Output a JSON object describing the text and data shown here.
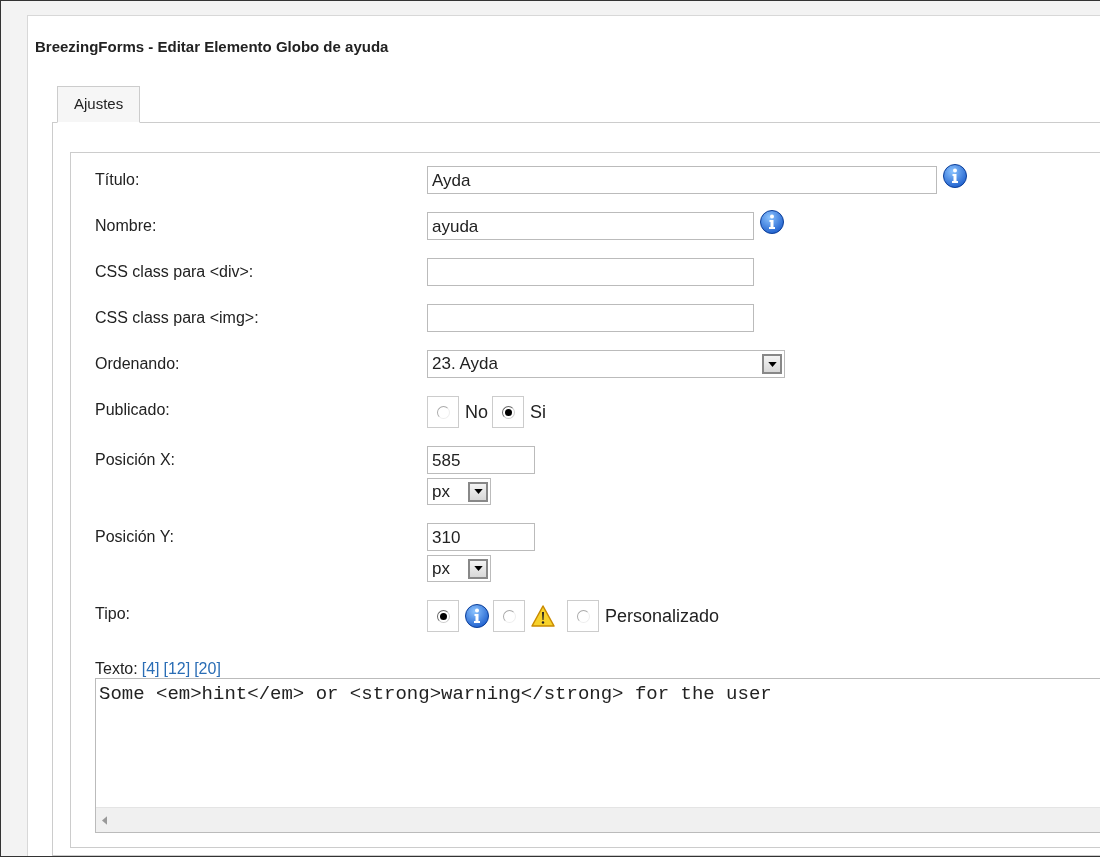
{
  "title": "BreezingForms - Editar Elemento Globo de ayuda",
  "tabs": [
    {
      "label": "Ajustes",
      "selected": true
    }
  ],
  "fields": [
    {
      "kind": "wide-text",
      "label": "Título:",
      "value": "Ayda",
      "info": true
    },
    {
      "kind": "text",
      "label": "Nombre:",
      "value": "ayuda",
      "info": true
    },
    {
      "kind": "text",
      "label": "CSS class para <div>:"
    },
    {
      "kind": "text",
      "label": "CSS class para <img>:"
    },
    {
      "kind": "select",
      "label": "Ordenando:",
      "value": "23. Ayda"
    },
    {
      "kind": "radios",
      "label": "Publicado:",
      "options": [
        {
          "kind": "text",
          "label": "No",
          "selected": false
        },
        {
          "kind": "text",
          "label": "Si",
          "selected": true
        }
      ]
    },
    {
      "kind": "position",
      "label": "Posición X:",
      "value": "585",
      "unit": "px"
    },
    {
      "kind": "position",
      "label": "Posición Y:",
      "value": "310",
      "unit": "px"
    },
    {
      "kind": "radios",
      "label": "Tipo:",
      "options": [
        {
          "kind": "info",
          "selected": true
        },
        {
          "kind": "warning",
          "selected": false
        },
        {
          "kind": "text",
          "label": "Personalizado",
          "selected": false
        }
      ]
    }
  ],
  "texto": {
    "label": "Texto:",
    "links": [
      "[4]",
      "[12]",
      "[20]"
    ],
    "value": "Some <em>hint</em> or <strong>warning</strong> for the user"
  }
}
